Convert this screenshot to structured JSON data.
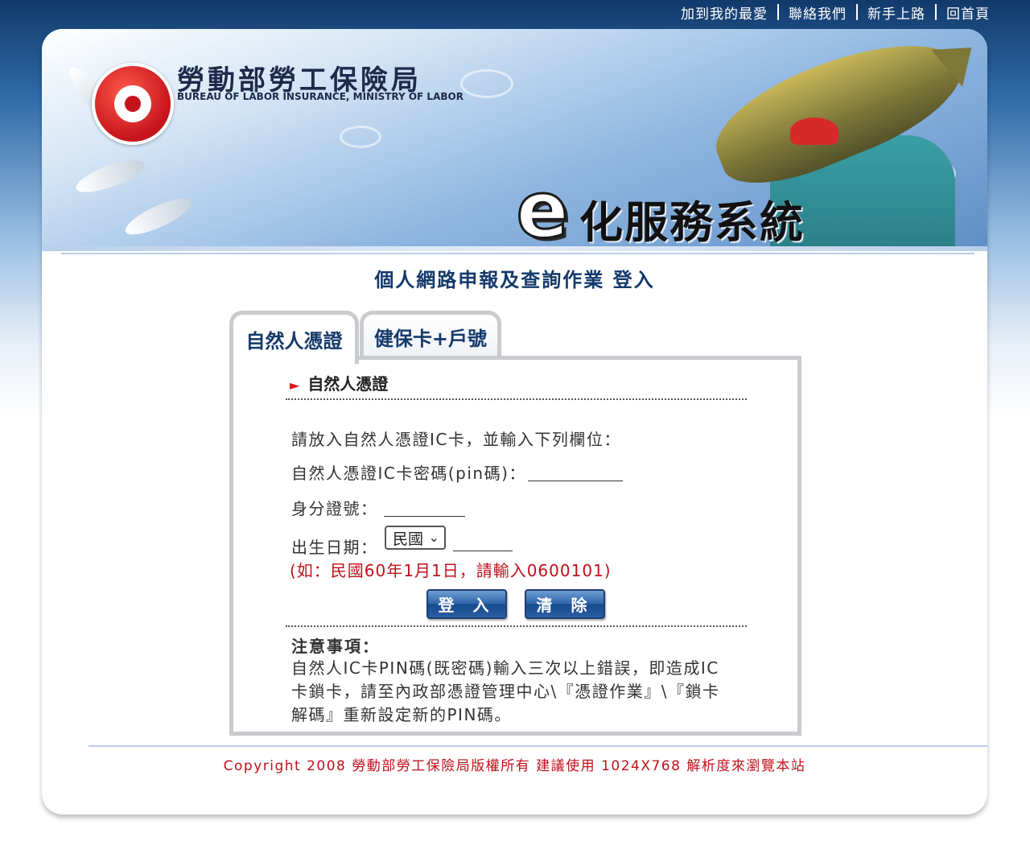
{
  "top_links": [
    "加到我的最愛",
    "聯絡我們",
    "新手上路",
    "回首頁"
  ],
  "org": {
    "name_zh": "勞動部勞工保險局",
    "name_en": "BUREAU OF LABOR INSURANCE, MINISTRY OF LABOR"
  },
  "banner": {
    "e_letter": "e",
    "system_title": "化服務系統"
  },
  "page_title": "個人網路申報及查詢作業 登入",
  "tabs": [
    "自然人憑證",
    "健保卡+戶號"
  ],
  "form": {
    "section_title": "自然人憑證",
    "intro": "請放入自然人憑證IC卡，並輸入下列欄位：",
    "pin_label": "自然人憑證IC卡密碼(pin碼)：",
    "pin_value": "",
    "id_label": "身分證號：",
    "id_value": "",
    "birth_label": "出生日期：",
    "era_selected": "民國",
    "birth_value": "",
    "hint": "(如：民國60年1月1日，請輸入0600101)",
    "login_label": "登 入",
    "clear_label": "清 除"
  },
  "notice": {
    "title": "注意事項：",
    "body": "自然人IC卡PIN碼(既密碼)輸入三次以上錯誤，即造成IC卡鎖卡，請至內政部憑證管理中心\\『憑證作業』\\『鎖卡解碼』重新設定新的PIN碼。"
  },
  "footer": {
    "copyright": "Copyright 2008 勞動部勞工保險局版權所有 建議使用 1024X768 解析度來瀏覽本站"
  },
  "colors": {
    "title": "#14396b",
    "accent_red": "#c0101a",
    "button": "#2b62a8"
  },
  "icons": {
    "section_marker": "right-triangle-icon",
    "select_chevron": "chevron-down-icon",
    "logo": "bli-logo-icon"
  }
}
